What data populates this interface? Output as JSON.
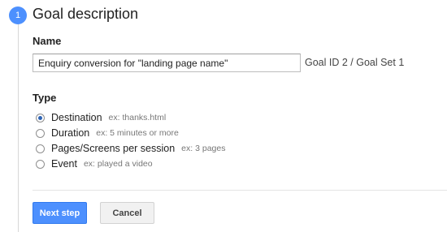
{
  "step": {
    "number": "1",
    "title": "Goal description"
  },
  "name_section": {
    "label": "Name",
    "input_value": "Enquiry conversion for \"landing page name\"",
    "goal_id_text": "Goal ID 2 / Goal Set 1"
  },
  "type_section": {
    "label": "Type",
    "options": [
      {
        "label": "Destination",
        "hint": "ex: thanks.html",
        "checked": true
      },
      {
        "label": "Duration",
        "hint": "ex: 5 minutes or more",
        "checked": false
      },
      {
        "label": "Pages/Screens per session",
        "hint": "ex: 3 pages",
        "checked": false
      },
      {
        "label": "Event",
        "hint": "ex: played a video",
        "checked": false
      }
    ]
  },
  "actions": {
    "next_label": "Next step",
    "cancel_label": "Cancel"
  },
  "colors": {
    "accent": "#4d90fe",
    "radio_dot": "#2e64b5"
  }
}
